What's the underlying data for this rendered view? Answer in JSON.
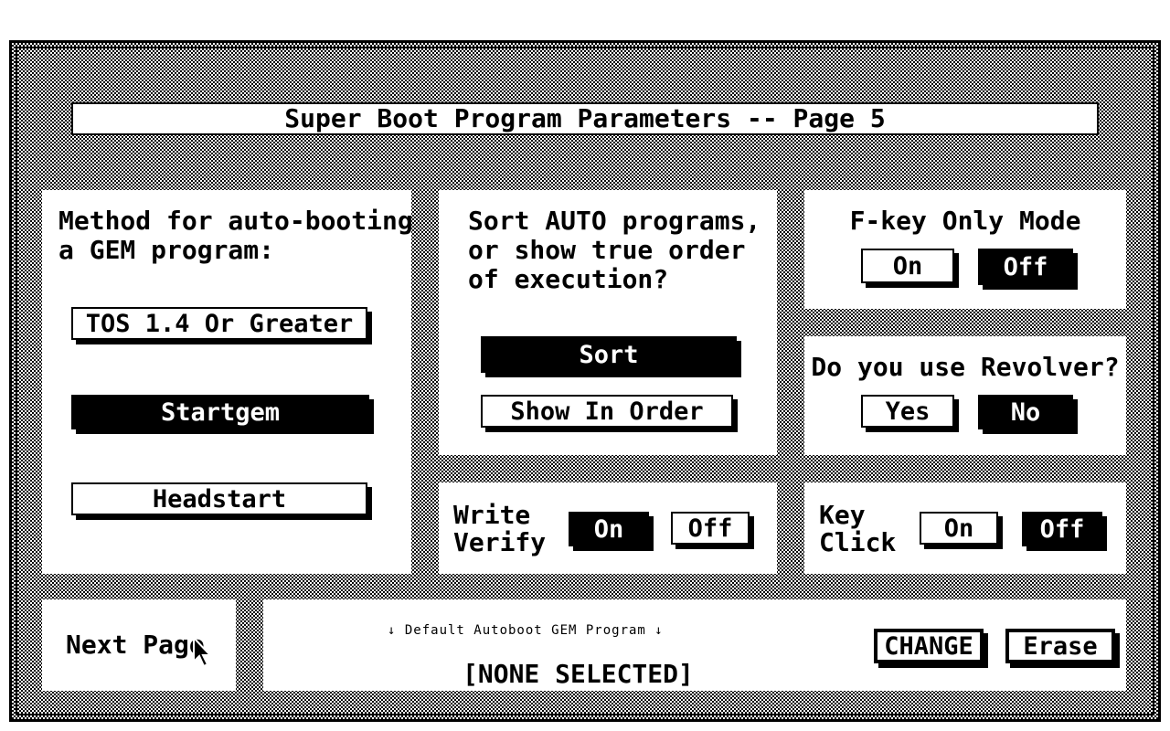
{
  "title": "Super Boot Program Parameters -- Page 5",
  "autoboot": {
    "heading_line1": "Method for auto-booting",
    "heading_line2": "a GEM program:",
    "options": [
      "TOS 1.4 Or Greater",
      "Startgem",
      "Headstart"
    ],
    "selected": "Startgem"
  },
  "sort": {
    "question_line1": "Sort AUTO programs,",
    "question_line2": "or show true order",
    "question_line3": "of execution?",
    "sort_label": "Sort",
    "show_label": "Show In Order",
    "selected": "Sort"
  },
  "fkey": {
    "title": "F-key Only Mode",
    "on_label": "On",
    "off_label": "Off",
    "selected": "Off"
  },
  "revolver": {
    "question": "Do you use Revolver?",
    "yes_label": "Yes",
    "no_label": "No",
    "selected": "No"
  },
  "write_verify": {
    "label_line1": "Write",
    "label_line2": "Verify",
    "on_label": "On",
    "off_label": "Off",
    "selected": "On"
  },
  "key_click": {
    "label_line1": "Key",
    "label_line2": "Click",
    "on_label": "On",
    "off_label": "Off",
    "selected": "Off"
  },
  "next_page": {
    "label": "Next Page"
  },
  "default_program": {
    "caption": "↓ Default Autoboot GEM Program ↓",
    "value": "[NONE SELECTED]",
    "change_label": "CHANGE",
    "erase_label": "Erase"
  },
  "colors": {
    "foreground": "#000000",
    "background": "#ffffff"
  }
}
